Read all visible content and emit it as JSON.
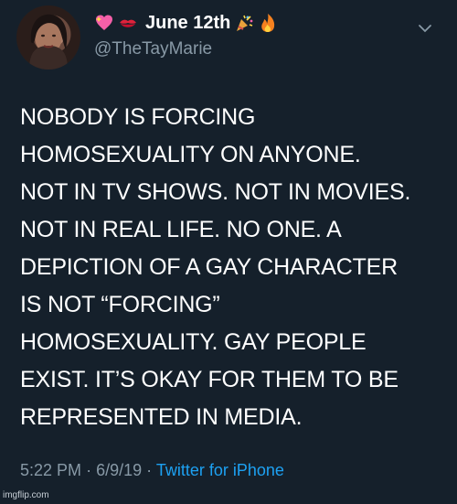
{
  "author": {
    "display_name": "June 12th",
    "handle": "@TheTayMarie",
    "name_emojis_before": [
      "sparkling-heart-icon",
      "kiss-mark-icon"
    ],
    "name_emojis_after": [
      "party-popper-icon",
      "fire-icon"
    ]
  },
  "tweet": {
    "lines": [
      "NOBODY IS FORCING",
      "HOMOSEXUALITY ON ANYONE.",
      "NOT IN TV SHOWS. NOT IN MOVIES.",
      "NOT IN REAL LIFE. NO ONE. A",
      "DEPICTION OF A GAY CHARACTER",
      "IS NOT “FORCING”",
      "HOMOSEXUALITY. GAY PEOPLE",
      "EXIST. IT’S OKAY FOR THEM TO BE",
      "REPRESENTED IN MEDIA."
    ],
    "time": "5:22 PM",
    "date": "6/9/19",
    "separator": "·",
    "source": "Twitter for iPhone"
  },
  "watermark": "imgflip.com",
  "colors": {
    "background": "#15202b",
    "text": "#ffffff",
    "secondary": "#8899a6",
    "link": "#1da1f2"
  }
}
